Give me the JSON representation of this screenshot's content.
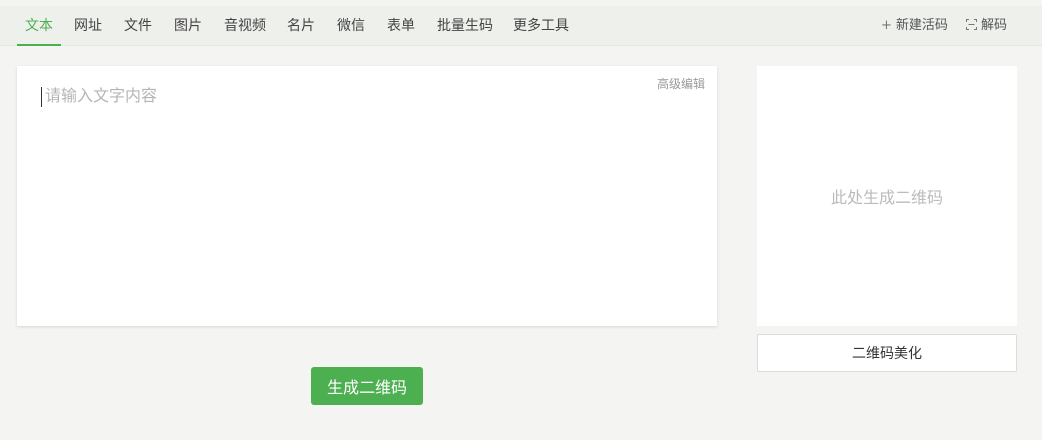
{
  "tabs": [
    {
      "label": "文本",
      "active": true
    },
    {
      "label": "网址"
    },
    {
      "label": "文件"
    },
    {
      "label": "图片"
    },
    {
      "label": "音视频"
    },
    {
      "label": "名片"
    },
    {
      "label": "微信"
    },
    {
      "label": "表单"
    },
    {
      "label": "批量生码"
    },
    {
      "label": "更多工具"
    }
  ],
  "actions": {
    "new_live_code": {
      "icon": "plus-icon",
      "label": "新建活码"
    },
    "decode": {
      "icon": "scan-icon",
      "label": "解码"
    }
  },
  "editor": {
    "placeholder": "请输入文字内容",
    "value": "",
    "advanced_label": "高级编辑"
  },
  "generate_label": "生成二维码",
  "preview": {
    "placeholder": "此处生成二维码",
    "beautify_label": "二维码美化"
  },
  "colors": {
    "accent": "#4caf50",
    "background": "#f4f5f2"
  }
}
